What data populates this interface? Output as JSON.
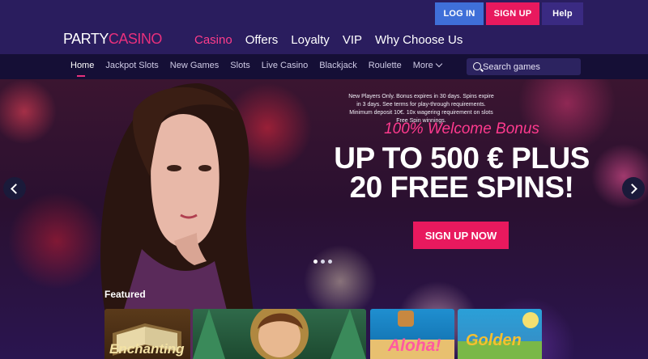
{
  "header": {
    "logo_part1": "PARTY",
    "logo_part2": "CASINO",
    "login_label": "LOG IN",
    "signup_label": "SIGN UP",
    "help_label": "Help",
    "main_nav": [
      "Casino",
      "Offers",
      "Loyalty",
      "VIP",
      "Why Choose Us"
    ]
  },
  "subnav": {
    "items": [
      "Home",
      "Jackpot Slots",
      "New Games",
      "Slots",
      "Live Casino",
      "Blackjack",
      "Roulette",
      "More"
    ],
    "search_placeholder": "Search games"
  },
  "hero": {
    "terms": "New Players Only. Bonus expires in 30 days. Spins expire in 3 days. See terms for play-through requirements. Minimum deposit 10€. 10x wagering requirement on slots Free Spin winnings.",
    "bonus_title": "100% Welcome Bonus",
    "headline_line1": "UP TO 500 € PLUS",
    "headline_line2": "20 FREE SPINS!",
    "cta_label": "SIGN UP NOW"
  },
  "featured": {
    "title": "Featured",
    "games": [
      "Enchanting",
      "Aloha!",
      "Golden"
    ]
  },
  "colors": {
    "accent_pink": "#e8195e",
    "login_blue": "#3f6fd8",
    "nav_bg": "#2a1d5e"
  }
}
